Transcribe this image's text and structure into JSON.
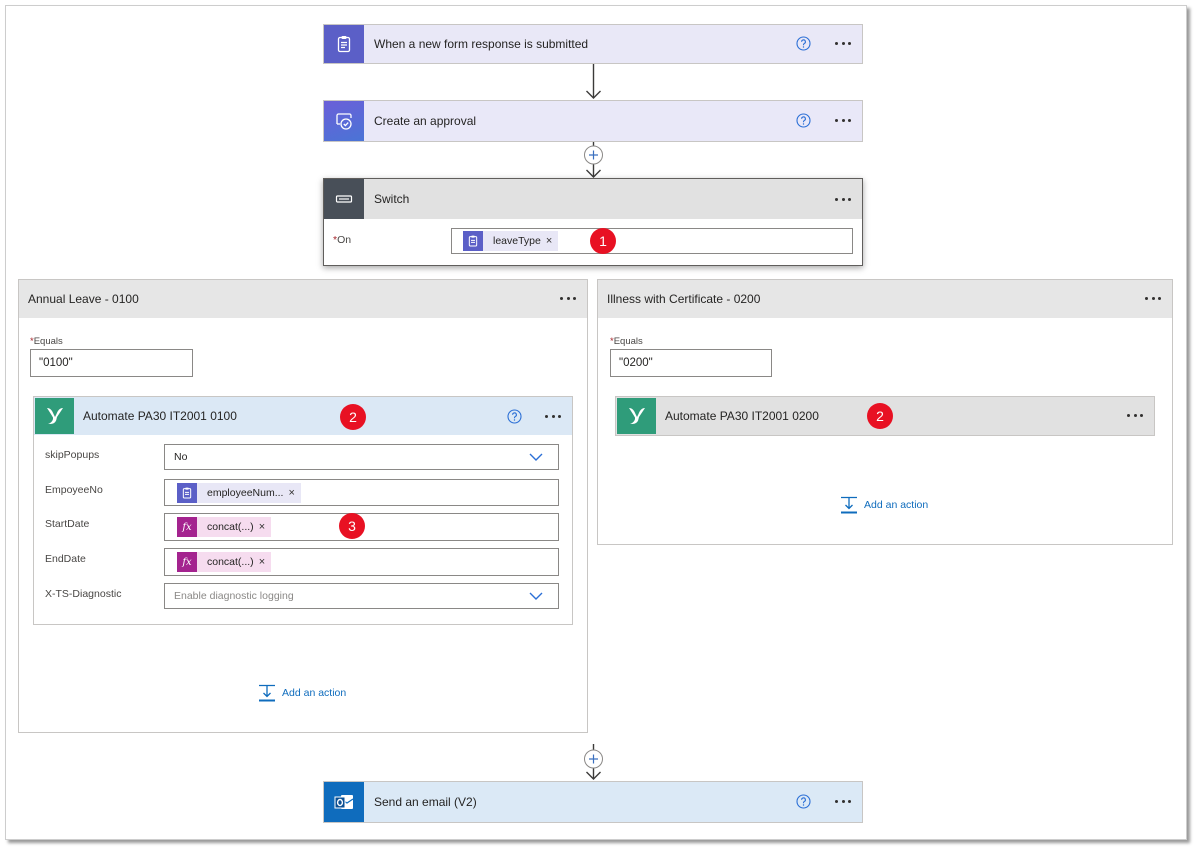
{
  "colors": {
    "forms": "#5b5fc7",
    "approvals": "#5b5fc7",
    "control": "#484f58",
    "custom_connector": "#2f9c7a",
    "outlook": "#0f6cbd",
    "expression": "#a4238f",
    "annotation": "#e81123",
    "link": "#0f6cbd"
  },
  "insert_step_icon": "plus-circle-icon",
  "trigger": {
    "title": "When a new form response is submitted",
    "icon": "forms-icon",
    "help_icon": "help-icon",
    "menu_icon": "more-options-icon"
  },
  "approval": {
    "title": "Create an approval",
    "icon": "approval-icon",
    "help_icon": "help-icon",
    "menu_icon": "more-options-icon"
  },
  "switch": {
    "title": "Switch",
    "icon": "switch-icon",
    "menu_icon": "more-options-icon",
    "on": {
      "required_mark": "*",
      "label": "On",
      "token": {
        "label": "leaveType",
        "icon": "forms-icon",
        "remove": "×"
      },
      "annotation": "1"
    }
  },
  "cases": [
    {
      "title": "Annual Leave - 0100",
      "equals": {
        "required_mark": "*",
        "label": "Equals",
        "value": "\"0100\""
      },
      "action": {
        "title": "Automate PA30 IT2001 0100",
        "icon": "automate-icon",
        "annotation": "2",
        "fields": [
          {
            "label": "skipPopups",
            "value": "No"
          },
          {
            "label": "EmpoyeeNo",
            "token": {
              "label": "employeeNum...",
              "icon": "forms-icon",
              "remove": "×"
            }
          },
          {
            "label": "StartDate",
            "token": {
              "label": "concat(...)",
              "icon": "fx-icon",
              "glyph": "fx",
              "remove": "×"
            },
            "annotation": "3"
          },
          {
            "label": "EndDate",
            "token": {
              "label": "concat(...)",
              "icon": "fx-icon",
              "glyph": "fx",
              "remove": "×"
            }
          },
          {
            "label": "X-TS-Diagnostic",
            "placeholder": "Enable diagnostic logging"
          }
        ]
      },
      "add_action": {
        "label": "Add an action",
        "icon": "add-action-icon"
      }
    },
    {
      "title": "Illness with Certificate - 0200",
      "equals": {
        "required_mark": "*",
        "label": "Equals",
        "value": "\"0200\""
      },
      "action": {
        "title": "Automate PA30 IT2001 0200",
        "icon": "automate-icon",
        "annotation": "2"
      },
      "add_action": {
        "label": "Add an action",
        "icon": "add-action-icon"
      }
    }
  ],
  "email": {
    "title": "Send an email (V2)",
    "icon": "outlook-icon",
    "help_icon": "help-icon",
    "menu_icon": "more-options-icon"
  }
}
